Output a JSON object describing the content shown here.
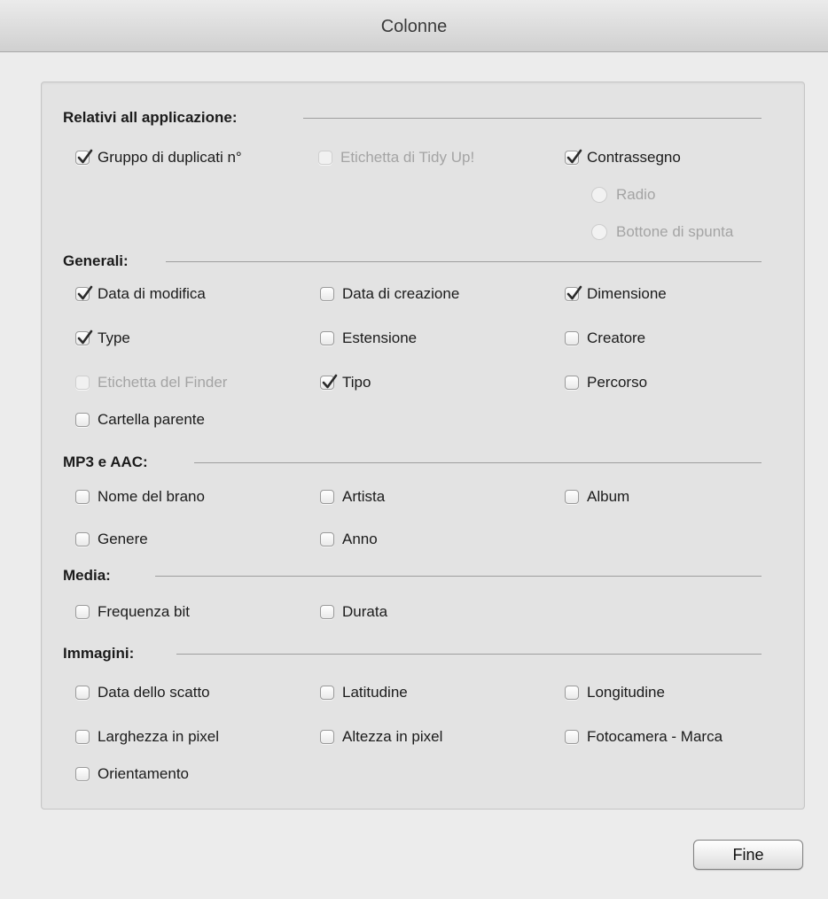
{
  "window": {
    "title": "Colonne"
  },
  "sections": [
    {
      "title": "Relativi all applicazione:",
      "items": [
        {
          "label": "Gruppo di duplicati n°",
          "checked": true,
          "disabled": false
        },
        {
          "label": "Etichetta di Tidy Up!",
          "checked": false,
          "disabled": true
        },
        {
          "label": "Contrassegno",
          "checked": true,
          "disabled": false
        }
      ],
      "radios": [
        {
          "label": "Radio",
          "disabled": true
        },
        {
          "label": "Bottone di spunta",
          "disabled": true
        }
      ]
    },
    {
      "title": "Generali:",
      "items": [
        {
          "label": "Data di modifica",
          "checked": true,
          "disabled": false
        },
        {
          "label": "Data di creazione",
          "checked": false,
          "disabled": false
        },
        {
          "label": "Dimensione",
          "checked": true,
          "disabled": false
        },
        {
          "label": "Type",
          "checked": true,
          "disabled": false
        },
        {
          "label": "Estensione",
          "checked": false,
          "disabled": false
        },
        {
          "label": "Creatore",
          "checked": false,
          "disabled": false
        },
        {
          "label": "Etichetta del Finder",
          "checked": false,
          "disabled": true
        },
        {
          "label": "Tipo",
          "checked": true,
          "disabled": false
        },
        {
          "label": "Percorso",
          "checked": false,
          "disabled": false
        },
        {
          "label": "Cartella parente",
          "checked": false,
          "disabled": false
        }
      ]
    },
    {
      "title": "MP3 e AAC:",
      "items": [
        {
          "label": "Nome del brano",
          "checked": false,
          "disabled": false
        },
        {
          "label": "Artista",
          "checked": false,
          "disabled": false
        },
        {
          "label": "Album",
          "checked": false,
          "disabled": false
        },
        {
          "label": "Genere",
          "checked": false,
          "disabled": false
        },
        {
          "label": "Anno",
          "checked": false,
          "disabled": false
        }
      ]
    },
    {
      "title": "Media:",
      "items": [
        {
          "label": "Frequenza bit",
          "checked": false,
          "disabled": false
        },
        {
          "label": "Durata",
          "checked": false,
          "disabled": false
        }
      ]
    },
    {
      "title": "Immagini:",
      "items": [
        {
          "label": "Data dello scatto",
          "checked": false,
          "disabled": false
        },
        {
          "label": "Latitudine",
          "checked": false,
          "disabled": false
        },
        {
          "label": "Longitudine",
          "checked": false,
          "disabled": false
        },
        {
          "label": "Larghezza in pixel",
          "checked": false,
          "disabled": false
        },
        {
          "label": "Altezza in pixel",
          "checked": false,
          "disabled": false
        },
        {
          "label": "Fotocamera - Marca",
          "checked": false,
          "disabled": false
        },
        {
          "label": "Orientamento",
          "checked": false,
          "disabled": false
        }
      ]
    }
  ],
  "footer": {
    "done_label": "Fine"
  }
}
